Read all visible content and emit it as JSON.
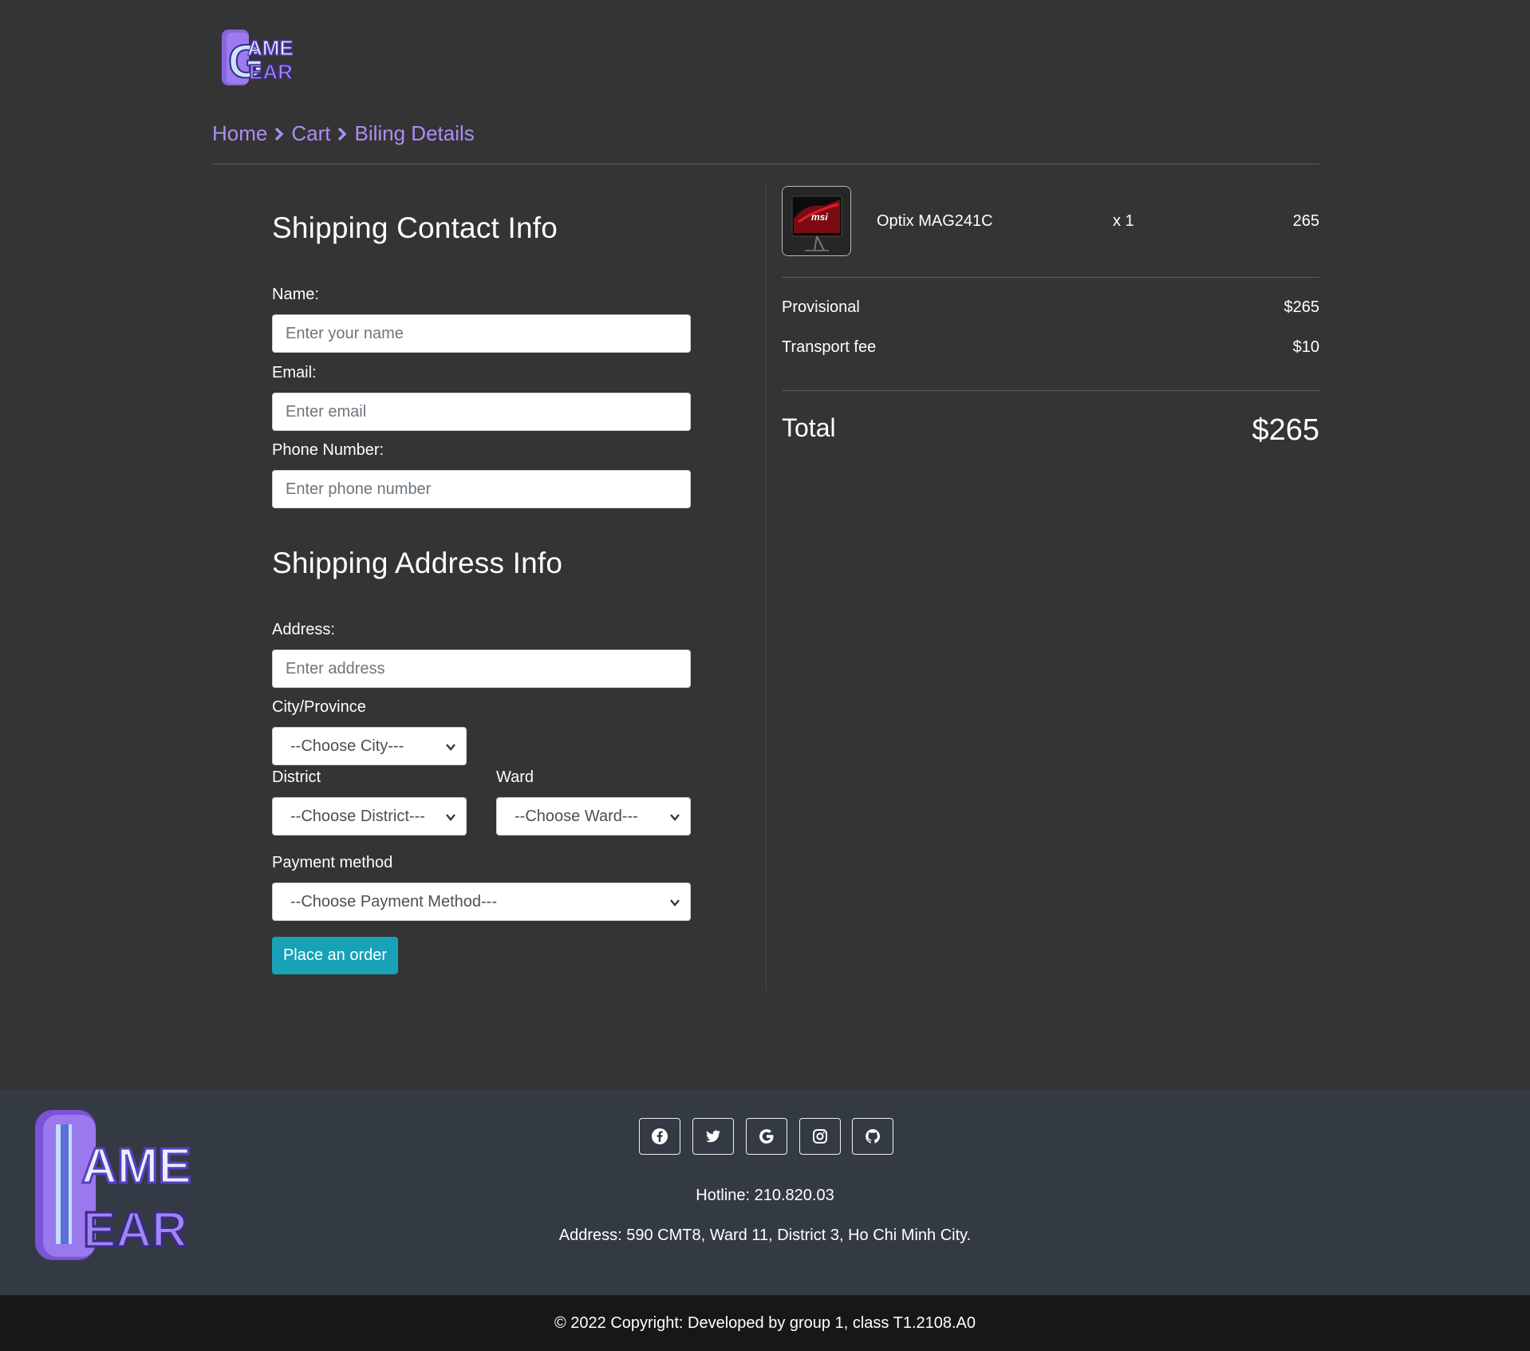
{
  "brand": {
    "logo_alt": "Game Gear logo",
    "logo_line1": "AME",
    "logo_line2": "EAR",
    "logo_letter": "G"
  },
  "breadcrumb": {
    "home": "Home",
    "cart": "Cart",
    "current": "Biling Details"
  },
  "contact": {
    "title": "Shipping Contact Info",
    "name_label": "Name:",
    "name_placeholder": "Enter your name",
    "email_label": "Email:",
    "email_placeholder": "Enter email",
    "phone_label": "Phone Number:",
    "phone_placeholder": "Enter phone number"
  },
  "address": {
    "title": "Shipping Address Info",
    "address_label": "Address:",
    "address_placeholder": "Enter address",
    "city_label": "City/Province",
    "city_value": "--Choose City---",
    "district_label": "District",
    "district_value": "--Choose District---",
    "ward_label": "Ward",
    "ward_value": "--Choose Ward---",
    "payment_label": "Payment method",
    "payment_value": "--Choose Payment Method---"
  },
  "order_button": "Place an order",
  "cart_item": {
    "name": "Optix MAG241C",
    "quantity": "x 1",
    "price": "265",
    "brand_mark": "msi"
  },
  "summary": {
    "provisional_label": "Provisional",
    "provisional_value": "$265",
    "transport_label": "Transport fee",
    "transport_value": "$10",
    "total_label": "Total",
    "total_value": "$265"
  },
  "footer": {
    "social_icons": [
      "facebook-icon",
      "twitter-icon",
      "google-icon",
      "instagram-icon",
      "github-icon"
    ],
    "hotline": "Hotline: 210.820.03",
    "address": "Address: 590 CMT8, Ward 11, District 3, Ho Chi Minh City.",
    "copyright": "© 2022 Copyright: Developed by group 1, class T1.2108.A0"
  },
  "colors": {
    "page_bg": "#343434",
    "accent": "#ab8ef5",
    "button": "#17a2b8",
    "footer_bg": "#343a44",
    "copyright_bg": "#171717"
  }
}
